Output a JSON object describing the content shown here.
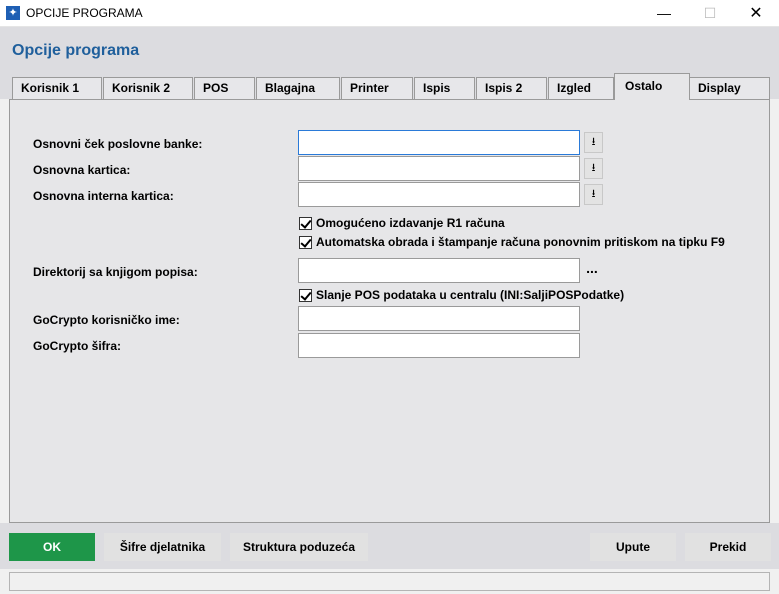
{
  "window": {
    "title": "OPCIJE PROGRAMA",
    "icon": "app-star-icon",
    "minimize_glyph": "—",
    "maximize_glyph": "☐",
    "close_glyph": "✕"
  },
  "header": {
    "title": "Opcije programa"
  },
  "tabs": [
    {
      "label": "Korisnik 1"
    },
    {
      "label": "Korisnik 2"
    },
    {
      "label": "POS"
    },
    {
      "label": "Blagajna"
    },
    {
      "label": "Printer"
    },
    {
      "label": "Ispis"
    },
    {
      "label": "Ispis 2"
    },
    {
      "label": "Izgled"
    },
    {
      "label": "Ostalo",
      "active": true
    },
    {
      "label": "Display"
    }
  ],
  "form": {
    "cek_label": "Osnovni ček poslovne banke:",
    "cek_value": "",
    "kartica_label": "Osnovna kartica:",
    "kartica_value": "",
    "interna_label": "Osnovna interna kartica:",
    "interna_value": "",
    "dropdown_glyph": "⭳",
    "r1_label": "Omogućeno izdavanje R1 računa",
    "r1_checked": true,
    "f9_label": "Automatska obrada i štampanje računa ponovnim pritiskom na tipku F9",
    "f9_checked": true,
    "direktorij_label": "Direktorij sa knjigom popisa:",
    "direktorij_value": "",
    "browse_glyph": "...",
    "slanje_label": "Slanje POS podataka u centralu (INI:SaljiPOSPodatke)",
    "slanje_checked": true,
    "gocrypto_user_label": "GoCrypto korisničko ime:",
    "gocrypto_user_value": "",
    "gocrypto_pass_label": "GoCrypto šifra:",
    "gocrypto_pass_value": ""
  },
  "footer": {
    "ok": "OK",
    "sifre": "Šifre djelatnika",
    "struktura": "Struktura poduzeća",
    "upute": "Upute",
    "prekid": "Prekid"
  },
  "colors": {
    "accent_title": "#1f5f9c",
    "ok_button": "#1e9649",
    "focus_border": "#2a7ad8"
  },
  "status": {
    "text": ""
  }
}
